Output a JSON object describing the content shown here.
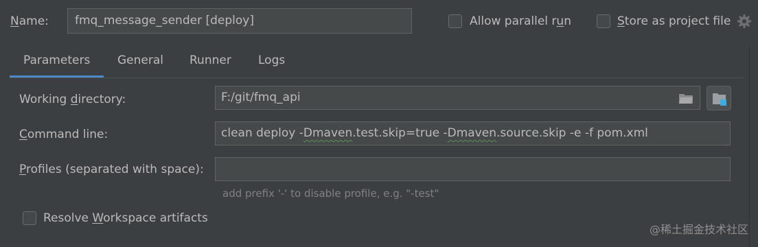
{
  "header": {
    "name_label": "Name:",
    "name_value": "fmq_message_sender [deploy]",
    "allow_parallel_label": "Allow parallel run",
    "allow_parallel_checked": false,
    "store_project_label": "Store as project file",
    "store_project_checked": false,
    "settings_icon": "gear-icon"
  },
  "tabs": [
    {
      "label": "Parameters",
      "active": true
    },
    {
      "label": "General",
      "active": false
    },
    {
      "label": "Runner",
      "active": false
    },
    {
      "label": "Logs",
      "active": false
    }
  ],
  "parameters": {
    "working_dir_label": "Working directory:",
    "working_dir_value": "F:/git/fmq_api",
    "command_line_label": "Command line:",
    "command_line_parts": [
      "clean deploy -",
      "Dmaven",
      ".test.skip=true -",
      "Dmaven",
      ".source.skip -e -f pom.xml"
    ],
    "profiles_label": "Profiles (separated with space):",
    "profiles_value": "",
    "profiles_hint": "add prefix '-' to disable profile, e.g. \"-test\"",
    "resolve_workspace_label": "Resolve Workspace artifacts",
    "resolve_workspace_checked": false
  },
  "colors": {
    "background": "#3c3f41",
    "field_background": "#45494a",
    "tab_underline": "#4a88c7",
    "text": "#bbbbbb"
  },
  "watermark": "@稀土掘金技术社区"
}
